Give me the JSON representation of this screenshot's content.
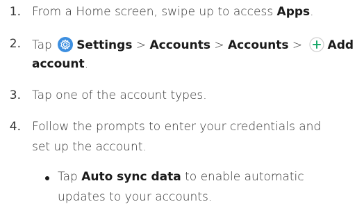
{
  "steps": [
    {
      "number": "1.",
      "lines": [
        {
          "a": "From a Home screen, swipe up to access ",
          "b": "Apps",
          "c": "."
        }
      ]
    },
    {
      "number": "2.",
      "tap": "Tap",
      "settings": "Settings",
      "sep": ">",
      "accounts": "Accounts",
      "add": "Add",
      "account": "account",
      "period": "."
    },
    {
      "number": "3.",
      "text": "Tap one of the account types."
    },
    {
      "number": "4.",
      "line1": "Follow the prompts to enter your credentials and",
      "line2": "set up the account."
    }
  ],
  "bullet": {
    "tap": "Tap ",
    "bold": "Auto sync data",
    "rest": " to enable automatic",
    "line2": "updates to your accounts."
  },
  "icons": {
    "settings_color": "#3d8fe0",
    "add_color": "#1aa86a"
  }
}
